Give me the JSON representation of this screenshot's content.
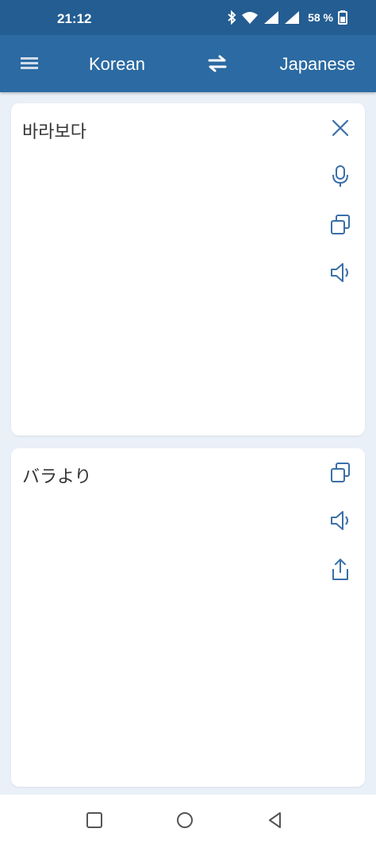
{
  "status_bar": {
    "time": "21:12",
    "battery": "58 %",
    "icons": [
      "bluetooth-icon",
      "wifi-icon",
      "signal-icon",
      "signal-icon",
      "battery-icon"
    ]
  },
  "app_bar": {
    "menu_icon": "menu-icon",
    "source_language": "Korean",
    "swap_icon": "swap-arrows-icon",
    "target_language": "Japanese"
  },
  "input_card": {
    "text": "바라보다",
    "actions": [
      "close-icon",
      "microphone-icon",
      "copy-icon",
      "speaker-icon"
    ]
  },
  "output_card": {
    "text": "バラより",
    "actions": [
      "copy-icon",
      "speaker-icon",
      "share-icon"
    ]
  },
  "nav_bar": {
    "buttons": [
      "recents-square-icon",
      "home-circle-icon",
      "back-triangle-icon"
    ]
  },
  "colors": {
    "status_bar": "#245d92",
    "app_bar": "#2b6aa2",
    "background": "#eaf0f7",
    "icon_blue": "#3a6fa8",
    "text": "#333333"
  }
}
